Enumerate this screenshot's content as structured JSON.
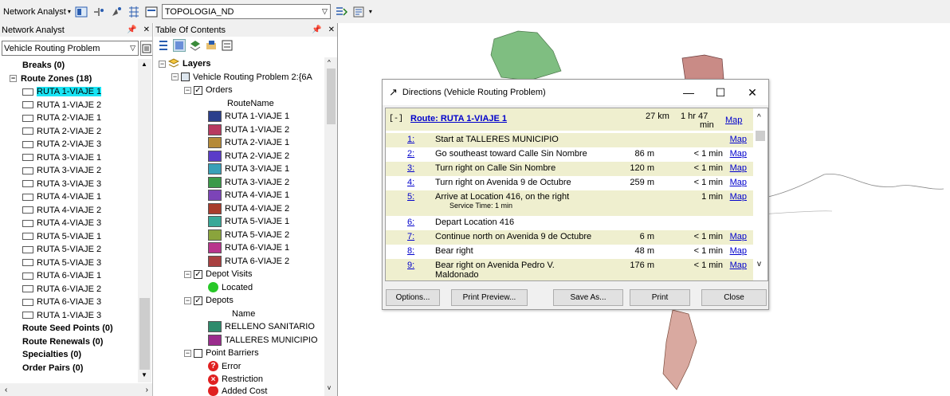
{
  "toolbar": {
    "network_analyst_label": "Network Analyst",
    "network_dataset": "TOPOLOGIA_ND"
  },
  "na_panel": {
    "title": "Network Analyst",
    "layer": "Vehicle Routing Problem",
    "items": [
      {
        "label": "Breaks (0)",
        "kind": "bold"
      },
      {
        "label": "Route Zones (18)",
        "kind": "group"
      },
      {
        "label": "RUTA 1-VIAJE 1",
        "kind": "item",
        "selected": true
      },
      {
        "label": "RUTA 1-VIAJE 2",
        "kind": "item"
      },
      {
        "label": "RUTA 2-VIAJE 1",
        "kind": "item"
      },
      {
        "label": "RUTA 2-VIAJE 2",
        "kind": "item"
      },
      {
        "label": "RUTA 2-VIAJE 3",
        "kind": "item"
      },
      {
        "label": "RUTA 3-VIAJE 1",
        "kind": "item"
      },
      {
        "label": "RUTA 3-VIAJE 2",
        "kind": "item"
      },
      {
        "label": "RUTA 3-VIAJE 3",
        "kind": "item"
      },
      {
        "label": "RUTA 4-VIAJE 1",
        "kind": "item"
      },
      {
        "label": "RUTA 4-VIAJE 2",
        "kind": "item"
      },
      {
        "label": "RUTA 4-VIAJE 3",
        "kind": "item"
      },
      {
        "label": "RUTA 5-VIAJE 1",
        "kind": "item"
      },
      {
        "label": "RUTA 5-VIAJE 2",
        "kind": "item"
      },
      {
        "label": "RUTA 5-VIAJE 3",
        "kind": "item"
      },
      {
        "label": "RUTA 6-VIAJE 1",
        "kind": "item"
      },
      {
        "label": "RUTA 6-VIAJE 2",
        "kind": "item"
      },
      {
        "label": "RUTA 6-VIAJE 3",
        "kind": "item"
      },
      {
        "label": "RUTA 1-VIAJE 3",
        "kind": "item"
      },
      {
        "label": "Route Seed Points (0)",
        "kind": "bold"
      },
      {
        "label": "Route Renewals (0)",
        "kind": "bold"
      },
      {
        "label": "Specialties (0)",
        "kind": "bold"
      },
      {
        "label": "Order Pairs (0)",
        "kind": "bold"
      }
    ]
  },
  "toc": {
    "title": "Table Of Contents",
    "layers_label": "Layers",
    "vrp_label": "Vehicle Routing Problem 2:{6A",
    "orders_label": "Orders",
    "routename_label": "RouteName",
    "orders": [
      {
        "label": "RUTA 1-VIAJE 1",
        "color": "#2b3f8c"
      },
      {
        "label": "RUTA 1-VIAJE 2",
        "color": "#b83a60"
      },
      {
        "label": "RUTA 2-VIAJE 1",
        "color": "#b58a38"
      },
      {
        "label": "RUTA 2-VIAJE 2",
        "color": "#5a3cc8"
      },
      {
        "label": "RUTA 3-VIAJE 1",
        "color": "#38a0b8"
      },
      {
        "label": "RUTA 3-VIAJE 2",
        "color": "#3a9a48"
      },
      {
        "label": "RUTA 4-VIAJE 1",
        "color": "#7c44b8"
      },
      {
        "label": "RUTA 4-VIAJE 2",
        "color": "#a83c2c"
      },
      {
        "label": "RUTA 5-VIAJE 1",
        "color": "#38a898"
      },
      {
        "label": "RUTA 5-VIAJE 2",
        "color": "#8aa43c"
      },
      {
        "label": "RUTA 6-VIAJE 1",
        "color": "#b8348c"
      },
      {
        "label": "RUTA 6-VIAJE 2",
        "color": "#a84040"
      }
    ],
    "depot_visits_label": "Depot Visits",
    "located_label": "Located",
    "depots_label": "Depots",
    "name_label": "Name",
    "depots": [
      {
        "label": "RELLENO SANITARIO",
        "color": "#2e8b6c"
      },
      {
        "label": "TALLERES MUNICIPIO",
        "color": "#9a2c8c"
      }
    ],
    "point_barriers_label": "Point Barriers",
    "error_label": "Error",
    "restriction_label": "Restriction",
    "added_cost_label": "Added Cost"
  },
  "directions": {
    "title": "Directions (Vehicle Routing Problem)",
    "collapse": "[-]",
    "route_label": "Route: RUTA 1-VIAJE 1",
    "route_dist": "27 km",
    "route_time_1": "1 hr 47",
    "route_time_2": "min",
    "map_link": "Map",
    "steps": [
      {
        "num": "1:",
        "text": "Start at TALLERES MUNICIPIO",
        "dist": "",
        "time": "",
        "map": "Map"
      },
      {
        "num": "2:",
        "text": "Go southeast toward Calle Sin Nombre",
        "dist": "86 m",
        "time": "< 1 min",
        "map": "Map"
      },
      {
        "num": "3:",
        "text": "Turn right on Calle Sin Nombre",
        "dist": "120 m",
        "time": "< 1 min",
        "map": "Map"
      },
      {
        "num": "4:",
        "text": "Turn right on Avenida 9 de Octubre",
        "dist": "259 m",
        "time": "< 1 min",
        "map": "Map"
      },
      {
        "num": "5:",
        "text": "Arrive at Location 416, on the right",
        "sub": "Service Time: 1 min",
        "dist": "",
        "time": "1 min",
        "map": "Map"
      },
      {
        "num": "6:",
        "text": "Depart Location 416",
        "dist": "",
        "time": "",
        "map": ""
      },
      {
        "num": "7:",
        "text": "Continue north on Avenida 9 de Octubre",
        "dist": "6 m",
        "time": "< 1 min",
        "map": "Map"
      },
      {
        "num": "8:",
        "text": "Bear right",
        "dist": "48 m",
        "time": "< 1 min",
        "map": "Map"
      },
      {
        "num": "9:",
        "text": "Bear right on Avenida Pedro V.",
        "text2": "Maldonado",
        "dist": "176 m",
        "time": "< 1 min",
        "map": "Map"
      }
    ],
    "buttons": {
      "options": "Options...",
      "print_preview": "Print Preview...",
      "save_as": "Save As...",
      "print": "Print",
      "close": "Close"
    }
  }
}
